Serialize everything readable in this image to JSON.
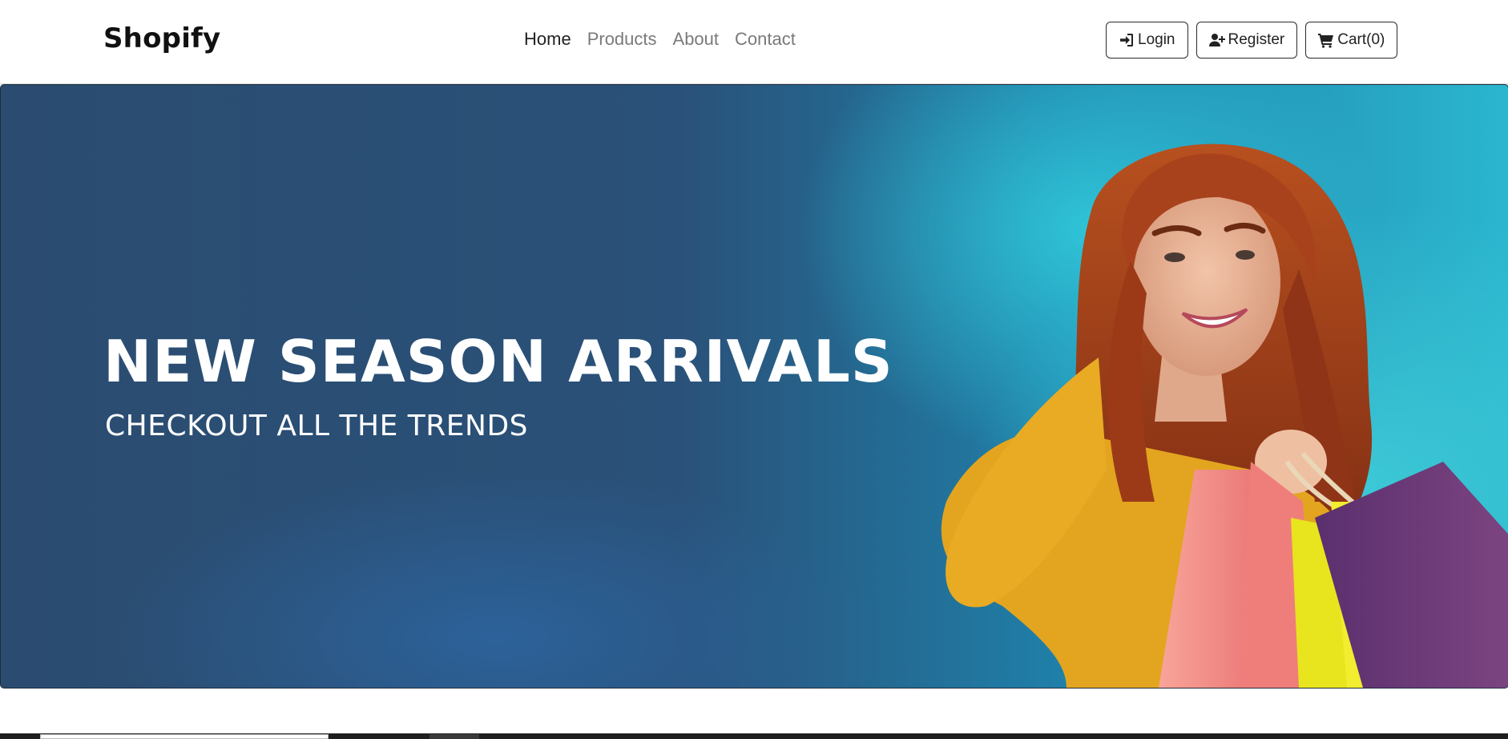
{
  "navbar": {
    "brand": "Shopify",
    "links": [
      {
        "label": "Home",
        "active": true
      },
      {
        "label": "Products",
        "active": false
      },
      {
        "label": "About",
        "active": false
      },
      {
        "label": "Contact",
        "active": false
      }
    ],
    "buttons": {
      "login": {
        "label": "Login",
        "icon": "sign-in-icon"
      },
      "register": {
        "label": "Register",
        "icon": "user-plus-icon"
      },
      "cart": {
        "label": "Cart(0)",
        "icon": "shopping-cart-icon"
      }
    }
  },
  "hero": {
    "title": "NEW SEASON ARRIVALS",
    "subtitle": "CHECKOUT ALL THE TRENDS",
    "image": "woman-with-shopping-bags",
    "colors": {
      "left": "#2b4c70",
      "right": "#2bb6cf",
      "hair": "#a8421c",
      "sweater": "#e2a41f"
    }
  }
}
